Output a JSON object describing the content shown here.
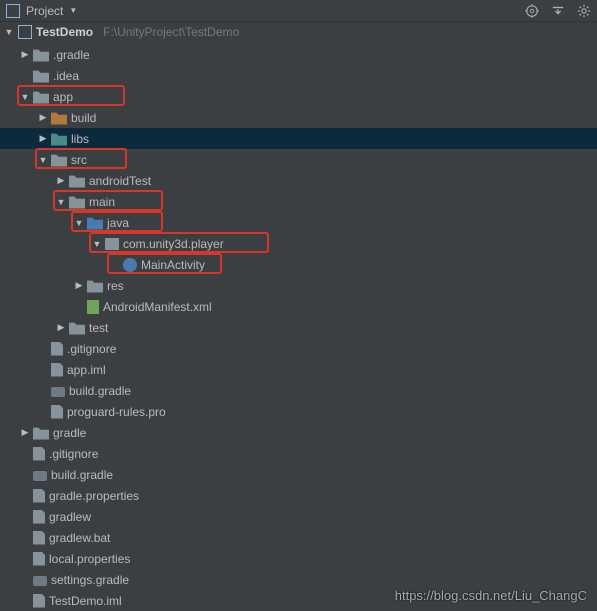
{
  "toolbar": {
    "title": "Project"
  },
  "project": {
    "name": "TestDemo",
    "path": "F:\\UnityProject\\TestDemo"
  },
  "tree": [
    {
      "indent": 20,
      "arrow": "collapsed",
      "icon": "folder-gray",
      "label": ".gradle"
    },
    {
      "indent": 20,
      "arrow": "none",
      "icon": "folder-gray",
      "label": ".idea"
    },
    {
      "indent": 20,
      "arrow": "expanded",
      "icon": "folder-gray",
      "label": "app",
      "hl": true,
      "hlw": 108
    },
    {
      "indent": 38,
      "arrow": "collapsed",
      "icon": "folder-orange",
      "label": "build"
    },
    {
      "indent": 38,
      "arrow": "collapsed",
      "icon": "folder-teal",
      "label": "libs",
      "selected": true
    },
    {
      "indent": 38,
      "arrow": "expanded",
      "icon": "folder-gray",
      "label": "src",
      "hl": true,
      "hlw": 92
    },
    {
      "indent": 56,
      "arrow": "collapsed",
      "icon": "folder-gray",
      "label": "androidTest"
    },
    {
      "indent": 56,
      "arrow": "expanded",
      "icon": "folder-gray",
      "label": "main",
      "hl": true,
      "hlw": 110
    },
    {
      "indent": 74,
      "arrow": "expanded",
      "icon": "folder-blue",
      "label": "java",
      "hl": true,
      "hlw": 92
    },
    {
      "indent": 92,
      "arrow": "expanded",
      "icon": "package-icon",
      "label": "com.unity3d.player",
      "hl": true,
      "hlw": 180
    },
    {
      "indent": 110,
      "arrow": "none",
      "icon": "class-icon",
      "label": "MainActivity",
      "hl": true,
      "hlw": 115
    },
    {
      "indent": 74,
      "arrow": "collapsed",
      "icon": "folder-gray file-res",
      "label": "res"
    },
    {
      "indent": 74,
      "arrow": "none",
      "icon": "manifest-icon",
      "label": "AndroidManifest.xml"
    },
    {
      "indent": 56,
      "arrow": "collapsed",
      "icon": "folder-gray",
      "label": "test"
    },
    {
      "indent": 38,
      "arrow": "none",
      "icon": "file-icon",
      "label": ".gitignore"
    },
    {
      "indent": 38,
      "arrow": "none",
      "icon": "file-icon",
      "label": "app.iml"
    },
    {
      "indent": 38,
      "arrow": "none",
      "icon": "file-gradle",
      "label": "build.gradle"
    },
    {
      "indent": 38,
      "arrow": "none",
      "icon": "file-icon",
      "label": "proguard-rules.pro"
    },
    {
      "indent": 20,
      "arrow": "collapsed",
      "icon": "folder-gray",
      "label": "gradle"
    },
    {
      "indent": 20,
      "arrow": "none",
      "icon": "file-icon",
      "label": ".gitignore"
    },
    {
      "indent": 20,
      "arrow": "none",
      "icon": "file-gradle",
      "label": "build.gradle"
    },
    {
      "indent": 20,
      "arrow": "none",
      "icon": "file-icon",
      "label": "gradle.properties"
    },
    {
      "indent": 20,
      "arrow": "none",
      "icon": "file-icon",
      "label": "gradlew"
    },
    {
      "indent": 20,
      "arrow": "none",
      "icon": "file-icon",
      "label": "gradlew.bat"
    },
    {
      "indent": 20,
      "arrow": "none",
      "icon": "file-icon",
      "label": "local.properties"
    },
    {
      "indent": 20,
      "arrow": "none",
      "icon": "file-gradle",
      "label": "settings.gradle"
    },
    {
      "indent": 20,
      "arrow": "none",
      "icon": "file-icon",
      "label": "TestDemo.iml"
    }
  ],
  "watermark": "https://blog.csdn.net/Liu_ChangC"
}
